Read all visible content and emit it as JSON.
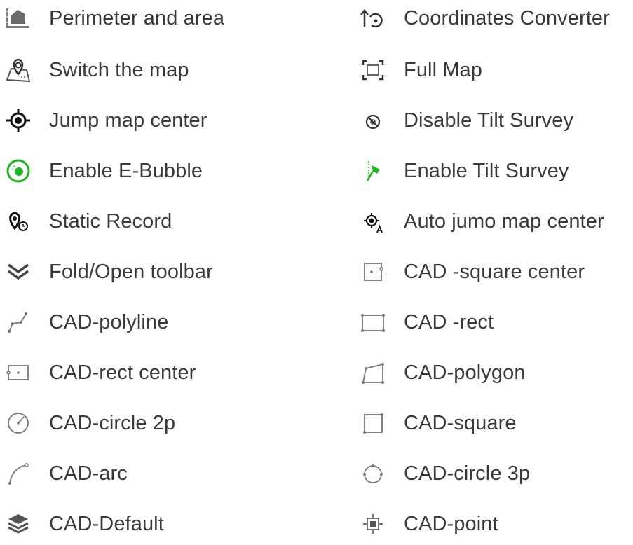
{
  "colors": {
    "text": "#3a3a3a",
    "icon_gray": "#6b6b6b",
    "icon_dark": "#111111",
    "accent_green": "#1fb51f"
  },
  "left": [
    {
      "label": "Perimeter and area",
      "icon": "perimeter-area-icon"
    },
    {
      "label": "Switch the map",
      "icon": "switch-map-icon"
    },
    {
      "label": "Jump map center",
      "icon": "jump-center-icon"
    },
    {
      "label": "Enable E-Bubble",
      "icon": "e-bubble-icon"
    },
    {
      "label": "Static Record",
      "icon": "static-record-icon"
    },
    {
      "label": "Fold/Open toolbar",
      "icon": "fold-toolbar-icon"
    },
    {
      "label": "CAD-polyline",
      "icon": "cad-polyline-icon"
    },
    {
      "label": "CAD-rect center",
      "icon": "cad-rect-center-icon"
    },
    {
      "label": "CAD-circle 2p",
      "icon": "cad-circle-2p-icon"
    },
    {
      "label": "CAD-arc",
      "icon": "cad-arc-icon"
    },
    {
      "label": "CAD-Default",
      "icon": "cad-default-icon"
    }
  ],
  "right": [
    {
      "label": "Coordinates Converter",
      "icon": "coordinates-converter-icon"
    },
    {
      "label": "Full Map",
      "icon": "full-map-icon"
    },
    {
      "label": "Disable Tilt Survey",
      "icon": "disable-tilt-icon"
    },
    {
      "label": "Enable Tilt Survey",
      "icon": "enable-tilt-icon"
    },
    {
      "label": "Auto jumo map center",
      "icon": "auto-jump-center-icon"
    },
    {
      "label": "CAD -square center",
      "icon": "cad-square-center-icon"
    },
    {
      "label": "CAD -rect",
      "icon": "cad-rect-icon"
    },
    {
      "label": "CAD-polygon",
      "icon": "cad-polygon-icon"
    },
    {
      "label": "CAD-square",
      "icon": "cad-square-icon"
    },
    {
      "label": "CAD-circle 3p",
      "icon": "cad-circle-3p-icon"
    },
    {
      "label": "CAD-point",
      "icon": "cad-point-icon"
    }
  ]
}
